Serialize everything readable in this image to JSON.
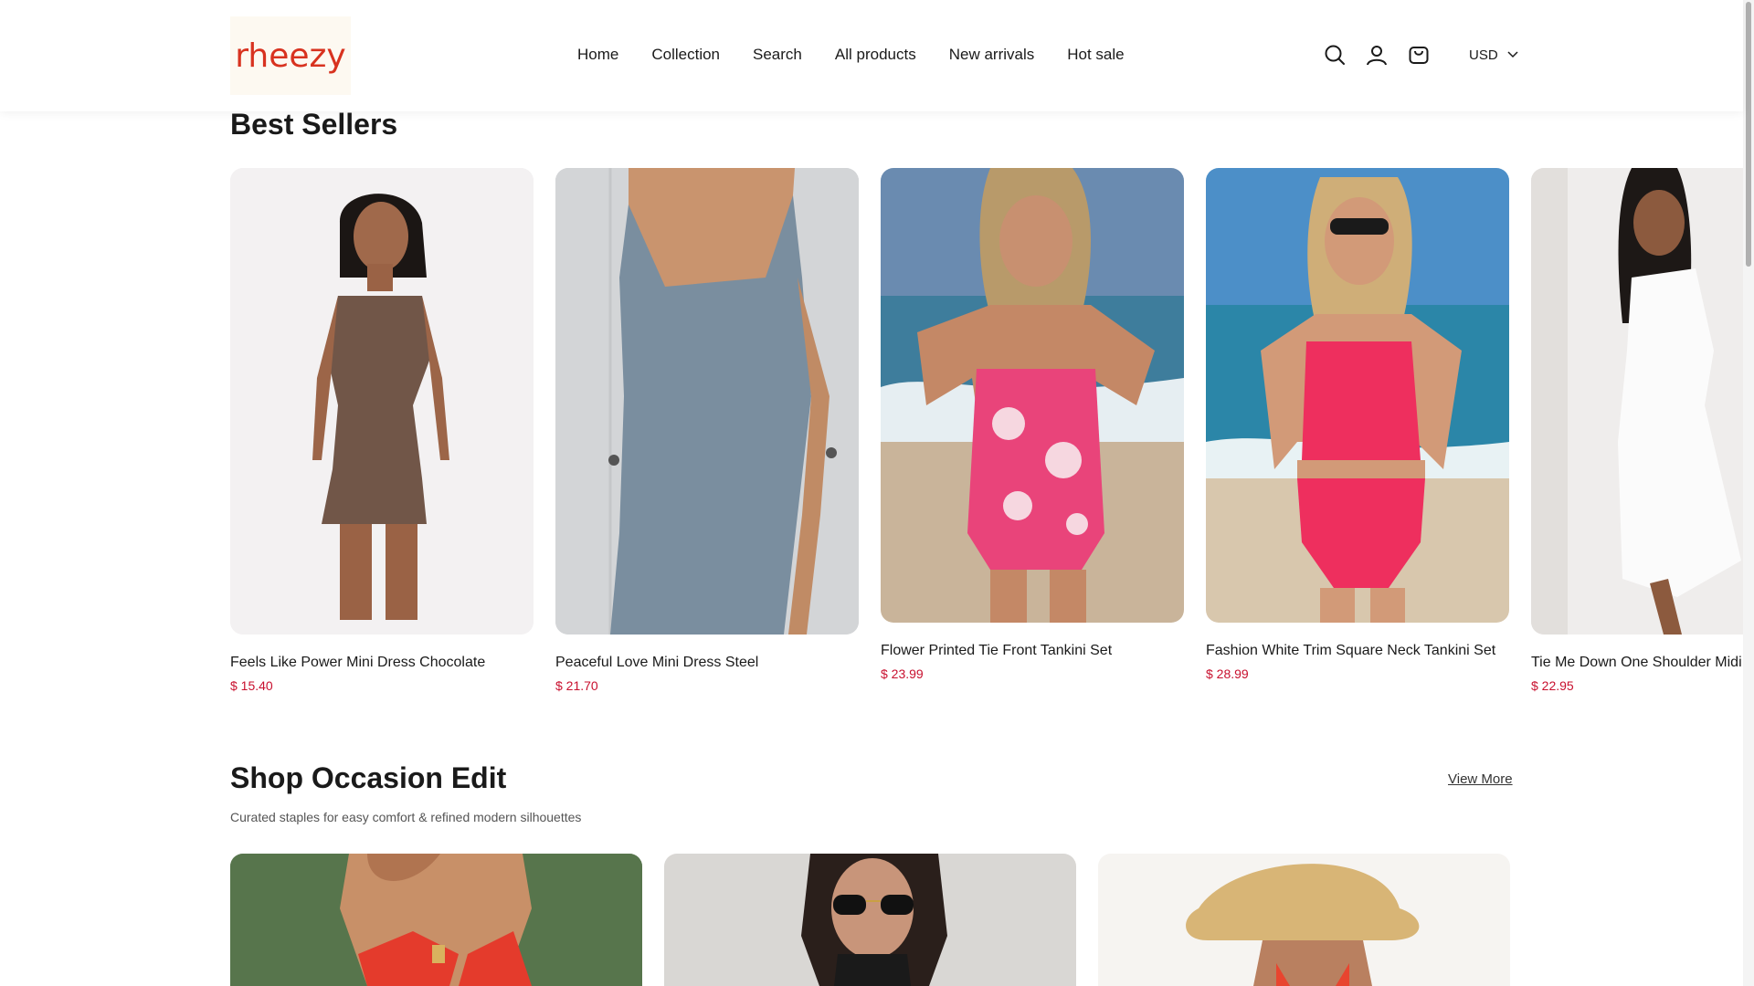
{
  "header": {
    "logo_text": "rheezy",
    "nav": [
      "Home",
      "Collection",
      "Search",
      "All products",
      "New arrivals",
      "Hot sale"
    ],
    "icons": [
      "search-icon",
      "account-icon",
      "cart-icon"
    ],
    "currency": "USD"
  },
  "best_sellers": {
    "title": "Best Sellers",
    "products": [
      {
        "title": "Feels Like Power Mini Dress Chocolate",
        "price": "$ 15.40"
      },
      {
        "title": "Peaceful Love Mini Dress Steel",
        "price": "$ 21.70"
      },
      {
        "title": "Flower Printed Tie Front Tankini Set",
        "price": "$ 23.99"
      },
      {
        "title": "Fashion White Trim Square Neck Tankini Set",
        "price": "$ 28.99"
      },
      {
        "title": "Tie Me Down One Shoulder Midi",
        "price": "$ 22.95"
      }
    ]
  },
  "occasion": {
    "title": "Shop Occasion Edit",
    "subtitle": "Curated staples for easy comfort & refined modern silhouettes",
    "view_more": "View More"
  },
  "colors": {
    "accent_price": "#c8102e",
    "logo": "#d8321f"
  }
}
